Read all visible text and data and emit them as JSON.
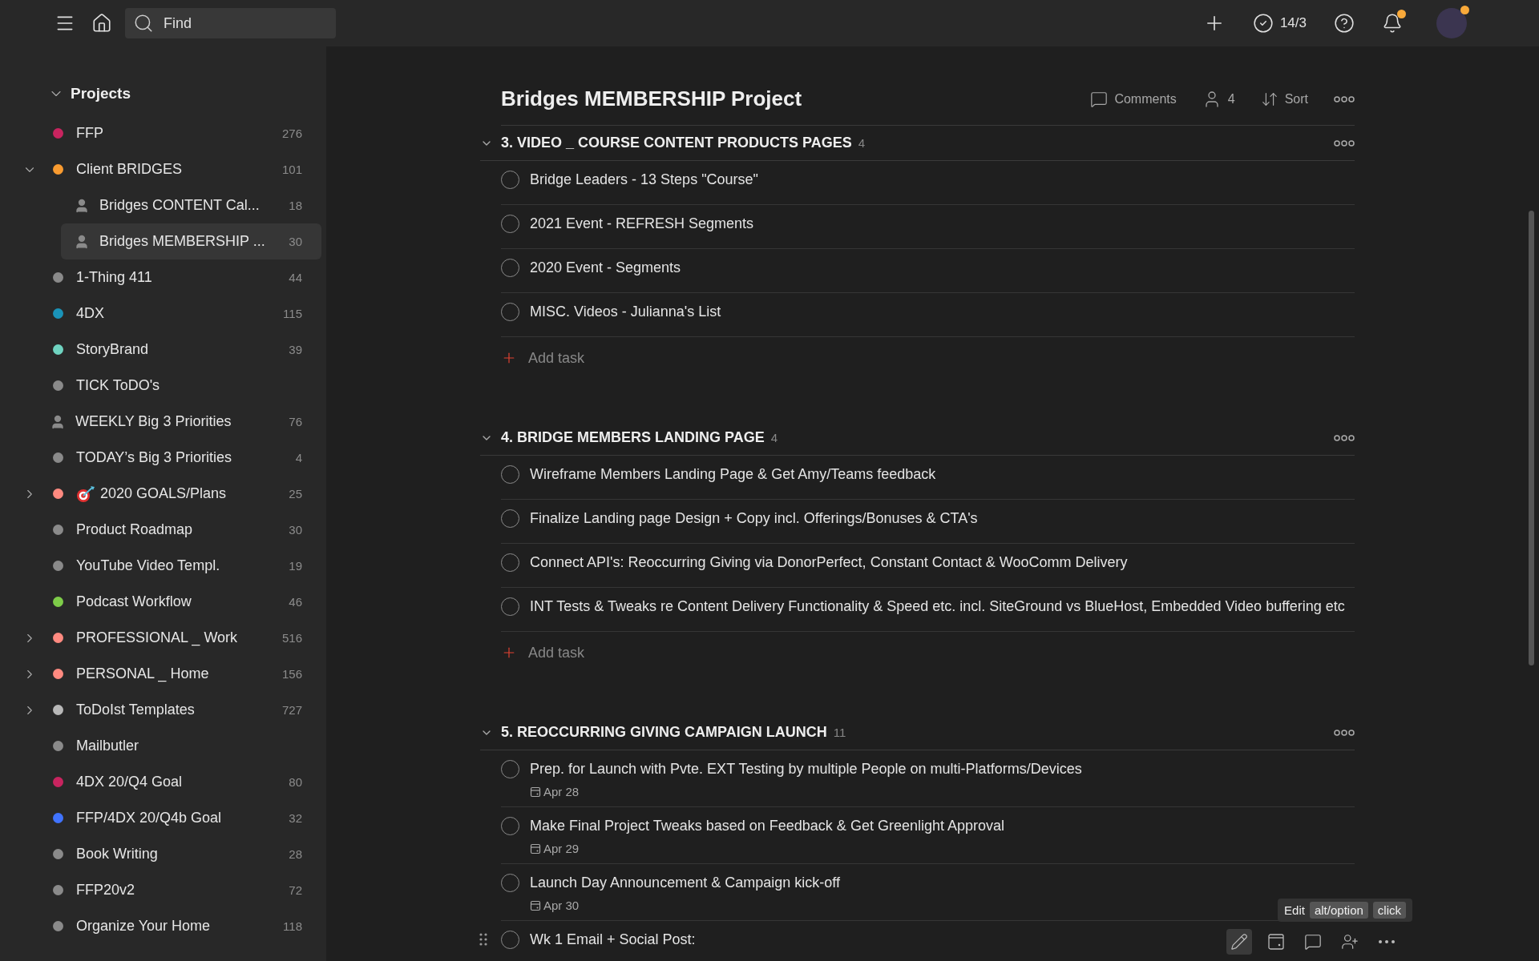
{
  "topbar": {
    "search": {
      "placeholder": "Find"
    },
    "karma": "14/3",
    "bell_badge": true,
    "avatar_badge": true
  },
  "sidebar": {
    "heading": "Projects",
    "expanded": true,
    "items": [
      {
        "name": "FFP",
        "count": "276",
        "kind": "dot",
        "color": "#c8245f",
        "selected": false
      },
      {
        "name": "Client BRIDGES",
        "count": "101",
        "kind": "dot",
        "color": "#f99b30",
        "selected": false,
        "expanded": true,
        "children": [
          {
            "name": "Bridges CONTENT Cal...",
            "count": "18",
            "kind": "shared",
            "selected": false
          },
          {
            "name": "Bridges MEMBERSHIP ...",
            "count": "30",
            "kind": "shared",
            "selected": true
          }
        ]
      },
      {
        "name": "1-Thing 411",
        "count": "44",
        "kind": "dot",
        "color": "#8a8a8a",
        "selected": false
      },
      {
        "name": "4DX",
        "count": "115",
        "kind": "dot",
        "color": "#1a93b8",
        "selected": false
      },
      {
        "name": "StoryBrand",
        "count": "39",
        "kind": "dot",
        "color": "#6fd3c0",
        "selected": false
      },
      {
        "name": "TICK ToDO's",
        "kind": "dot",
        "color": "#8a8a8a",
        "selected": false
      },
      {
        "name": "WEEKLY Big 3 Priorities",
        "count": "76",
        "kind": "shared",
        "selected": false
      },
      {
        "name": "TODAY’s Big 3 Priorities",
        "count": "4",
        "kind": "dot",
        "color": "#8a8a8a",
        "selected": false
      },
      {
        "name": "2020 GOALS/Plans",
        "count": "25",
        "kind": "goal",
        "color": "#ff8a80",
        "selected": false,
        "expanded": false
      },
      {
        "name": "Product Roadmap",
        "count": "30",
        "kind": "dot",
        "color": "#8a8a8a",
        "selected": false
      },
      {
        "name": "YouTube Video Templ.",
        "count": "19",
        "kind": "dot",
        "color": "#8a8a8a",
        "selected": false
      },
      {
        "name": "Podcast Workflow",
        "count": "46",
        "kind": "dot",
        "color": "#7ecc49",
        "selected": false
      },
      {
        "name": "PROFESSIONAL _ Work",
        "count": "516",
        "kind": "dot",
        "color": "#ff8a80",
        "selected": false,
        "expanded": false
      },
      {
        "name": "PERSONAL _ Home",
        "count": "156",
        "kind": "dot",
        "color": "#ff8a80",
        "selected": false,
        "expanded": false
      },
      {
        "name": "ToDoIst Templates",
        "count": "727",
        "kind": "dot",
        "color": "#b8b8b8",
        "selected": false,
        "expanded": false
      },
      {
        "name": "Mailbutler",
        "kind": "dot",
        "color": "#8a8a8a",
        "selected": false
      },
      {
        "name": "4DX 20/Q4 Goal",
        "count": "80",
        "kind": "dot",
        "color": "#c8245f",
        "selected": false
      },
      {
        "name": "FFP/4DX 20/Q4b Goal",
        "count": "32",
        "kind": "dot",
        "color": "#4073ff",
        "selected": false
      },
      {
        "name": "Book Writing",
        "count": "28",
        "kind": "dot",
        "color": "#8a8a8a",
        "selected": false
      },
      {
        "name": "FFP20v2",
        "count": "72",
        "kind": "dot",
        "color": "#8a8a8a",
        "selected": false
      },
      {
        "name": "Organize Your Home",
        "count": "118",
        "kind": "dot",
        "color": "#8a8a8a",
        "selected": false
      }
    ]
  },
  "project": {
    "title": "Bridges MEMBERSHIP Project",
    "actions": {
      "comments": "Comments",
      "people": "4",
      "sort": "Sort"
    },
    "sections": [
      {
        "title": "3. VIDEO _ COURSE CONTENT PRODUCTS PAGES",
        "count": "4",
        "expanded": true,
        "add_task": "Add task",
        "tasks": [
          {
            "text": "Bridge Leaders - 13 Steps \"Course\"",
            "hovered": false
          },
          {
            "text": "2021 Event - REFRESH Segments",
            "hovered": false
          },
          {
            "text": "2020 Event - Segments",
            "hovered": false
          },
          {
            "text": "MISC. Videos - Julianna's List",
            "hovered": false
          }
        ]
      },
      {
        "title": "4. BRIDGE MEMBERS LANDING PAGE",
        "count": "4",
        "expanded": true,
        "add_task": "Add task",
        "tasks": [
          {
            "text": "Wireframe Members Landing Page & Get Amy/Teams feedback",
            "hovered": false
          },
          {
            "text": "Finalize Landing page Design + Copy incl. Offerings/Bonuses & CTA's",
            "hovered": false
          },
          {
            "text": "Connect API's: Reoccurring Giving via DonorPerfect, Constant Contact & WooComm Delivery",
            "hovered": false
          },
          {
            "text": "INT Tests & Tweaks re Content Delivery Functionality & Speed etc. incl. SiteGround vs BlueHost, Embedded Video buffering etc",
            "hovered": false
          }
        ]
      },
      {
        "title": "5. REOCCURRING GIVING CAMPAIGN LAUNCH",
        "count": "11",
        "expanded": true,
        "tasks": [
          {
            "text": "Prep. for Launch with Pvte. EXT Testing by multiple People on multi-Platforms/Devices",
            "date": "Apr 28",
            "hovered": false
          },
          {
            "text": "Make Final Project Tweaks based on Feedback & Get Greenlight Approval",
            "date": "Apr 29",
            "hovered": false
          },
          {
            "text": "Launch Day Announcement & Campaign kick-off",
            "date": "Apr 30",
            "hovered": false
          },
          {
            "text": "Wk 1 Email + Social Post:",
            "hovered": true
          }
        ]
      }
    ]
  },
  "tooltip": {
    "label": "Edit",
    "keys": [
      "alt/option",
      "click"
    ]
  }
}
